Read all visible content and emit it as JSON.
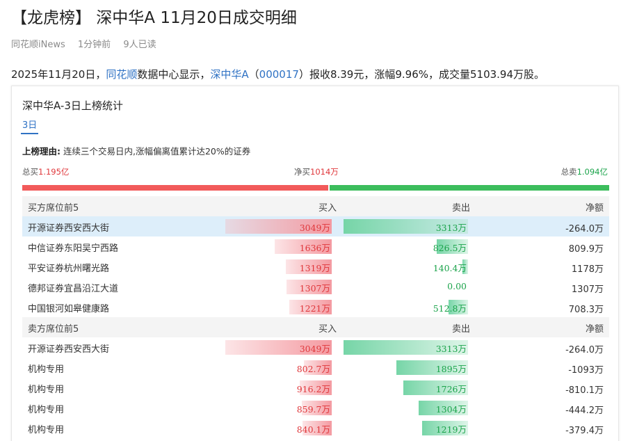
{
  "header": {
    "title": "【龙虎榜】 深中华A 11月20日成交明细",
    "source": "同花顺iNews",
    "time_ago": "1分钟前",
    "reads": "9人已读"
  },
  "summary": {
    "p1": "2025年11月20日，",
    "link_ths": "同花顺",
    "p2": "数据中心显示，",
    "link_stock": "深中华A",
    "p3": "（",
    "link_code": "000017",
    "p4": "）报收8.39元，涨幅9.96%，成交量5103.94万股。"
  },
  "card": {
    "title": "深中华A-3日上榜统计",
    "tab_label": "3日",
    "reason_label": "上榜理由:",
    "reason_text": " 连续三个交易日内,涨幅偏离值累计达20%的证券",
    "total_buy_label": "总买",
    "total_buy_value": "1.195亿",
    "net_buy_label": "净买",
    "net_buy_value": "1014万",
    "total_sell_label": "总卖",
    "total_sell_value": "1.094亿",
    "buy_fraction": 0.522
  },
  "buy_section": {
    "header": {
      "name": "买方席位前5",
      "buy": "买入",
      "sell": "卖出",
      "net": "净额"
    },
    "rows": [
      {
        "name": "开源证券西安西大街",
        "buy": "3049万",
        "sell": "3313万",
        "net": "-264.0万",
        "buy_amt": 3049,
        "sell_amt": 3313
      },
      {
        "name": "中信证券东阳吴宁西路",
        "buy": "1636万",
        "sell": "826.5万",
        "net": "809.9万",
        "buy_amt": 1636,
        "sell_amt": 826.5
      },
      {
        "name": "平安证券杭州曙光路",
        "buy": "1319万",
        "sell": "140.4万",
        "net": "1178万",
        "buy_amt": 1319,
        "sell_amt": 140.4
      },
      {
        "name": "德邦证券宜昌沿江大道",
        "buy": "1307万",
        "sell": "0.00",
        "net": "1307万",
        "buy_amt": 1307,
        "sell_amt": 0
      },
      {
        "name": "中国银河如皋健康路",
        "buy": "1221万",
        "sell": "512.8万",
        "net": "708.3万",
        "buy_amt": 1221,
        "sell_amt": 512.8
      }
    ]
  },
  "sell_section": {
    "header": {
      "name": "卖方席位前5",
      "buy": "买入",
      "sell": "卖出",
      "net": "净额"
    },
    "rows": [
      {
        "name": "开源证券西安西大街",
        "buy": "3049万",
        "sell": "3313万",
        "net": "-264.0万",
        "buy_amt": 3049,
        "sell_amt": 3313
      },
      {
        "name": "机构专用",
        "buy": "802.7万",
        "sell": "1895万",
        "net": "-1093万",
        "buy_amt": 802.7,
        "sell_amt": 1895
      },
      {
        "name": "机构专用",
        "buy": "916.2万",
        "sell": "1726万",
        "net": "-810.1万",
        "buy_amt": 916.2,
        "sell_amt": 1726
      },
      {
        "name": "机构专用",
        "buy": "859.7万",
        "sell": "1304万",
        "net": "-444.2万",
        "buy_amt": 859.7,
        "sell_amt": 1304
      },
      {
        "name": "机构专用",
        "buy": "840.1万",
        "sell": "1219万",
        "net": "-379.4万",
        "buy_amt": 840.1,
        "sell_amt": 1219
      }
    ]
  },
  "colors": {
    "red": "#e0373b",
    "green": "#1aa34a",
    "link": "#2f72c4",
    "highlight": "#ddeefa"
  }
}
